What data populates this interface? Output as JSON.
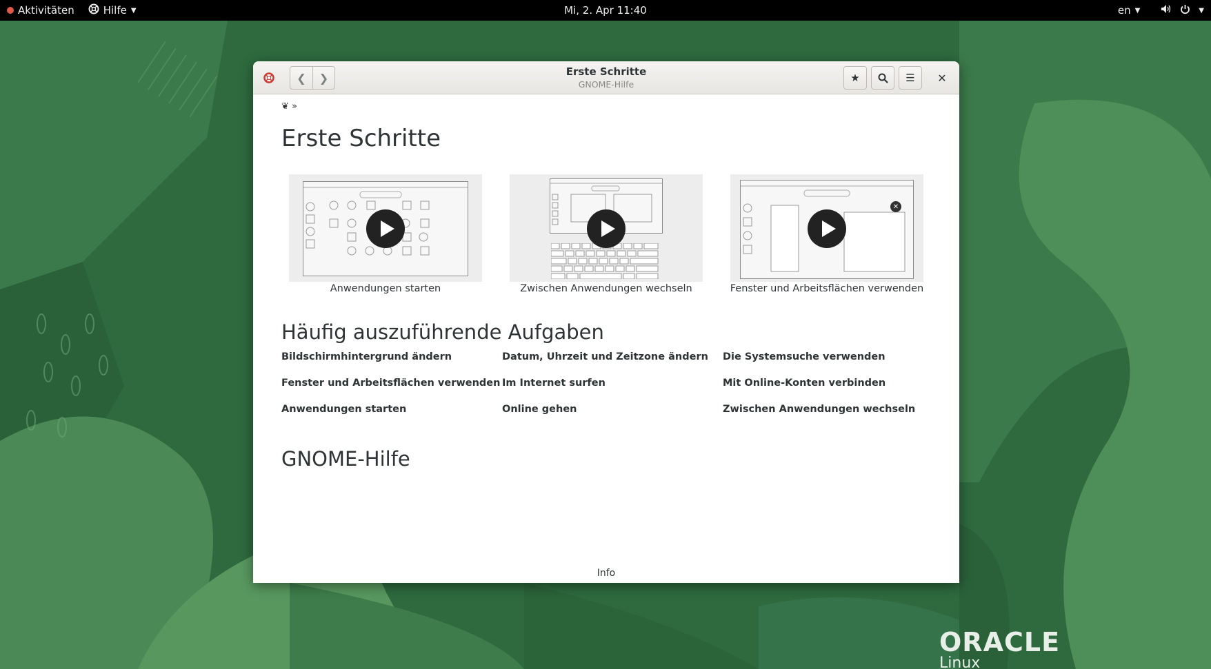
{
  "topbar": {
    "activities": "Aktivitäten",
    "app_menu": "Hilfe",
    "clock": "Mi,  2. Apr 11:40",
    "lang": "en"
  },
  "window": {
    "title": "Erste Schritte",
    "subtitle": "GNOME-Hilfe",
    "breadcrumb_sep": "»",
    "heading": "Erste Schritte",
    "videos": [
      {
        "caption": "Anwendungen starten"
      },
      {
        "caption": "Zwischen Anwendungen wechseln"
      },
      {
        "caption": "Fenster und Arbeitsflächen verwenden"
      }
    ],
    "tasks_heading": "Häufig auszuführende Aufgaben",
    "links": [
      "Bildschirmhintergrund ändern",
      "Datum, Uhrzeit und Zeitzone ändern",
      "Die Systemsuche verwenden",
      "Fenster und Arbeitsflächen verwenden",
      "Im Internet surfen",
      "Mit Online-Konten verbinden",
      "Anwendungen starten",
      "Online gehen",
      "Zwischen Anwendungen wechseln"
    ],
    "gnome_heading": "GNOME-Hilfe",
    "footer": "Info"
  },
  "branding": {
    "logo": "ORACLE",
    "sub": "Linux"
  },
  "colors": {
    "desktop_green": "#2f6b3f",
    "topbar": "#000000"
  }
}
